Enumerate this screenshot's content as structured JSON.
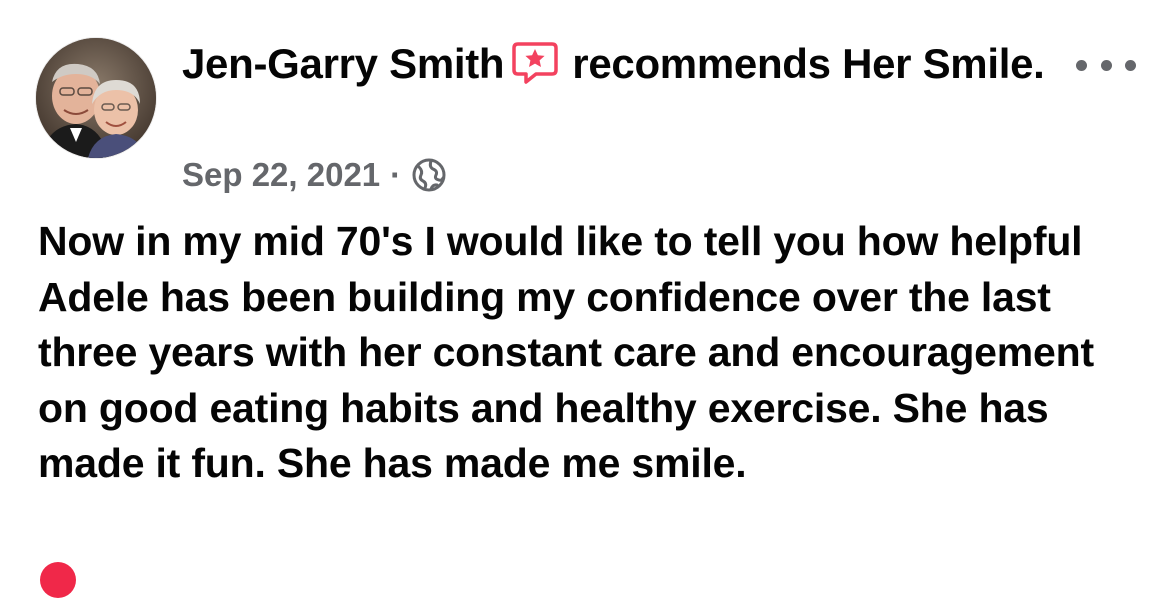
{
  "post": {
    "author": "Jen-Garry Smith",
    "recommends_word": "recommends",
    "page_name": "Her Smile.",
    "date": "Sep 22, 2021",
    "separator": "·",
    "privacy_icon": "globe-icon",
    "recommend_icon": "recommend-star-icon",
    "more_icon": "more-options-icon",
    "text": "Now in my mid 70's I would like to tell you how helpful Adele has been building my confidence over the last three years with her constant care and encouragement on good eating habits and healthy exercise. She has made it fun. She has made me smile."
  },
  "colors": {
    "text_primary": "#050505",
    "text_secondary": "#65676b",
    "recommend_accent": "#f3425f"
  }
}
